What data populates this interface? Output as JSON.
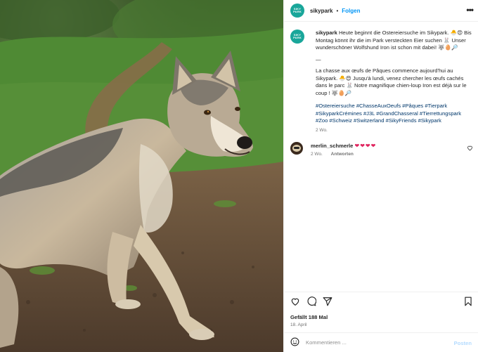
{
  "post": {
    "author": {
      "username": "sikypark",
      "avatar_text": "SIKY PARK"
    },
    "header": {
      "separator": "•",
      "follow_label": "Folgen",
      "more_label": "•••"
    },
    "caption": {
      "username": "sikypark",
      "text_de": "Heute beginnt die Ostereiersuche im Sikypark. 🐣😍 Bis Montag könnt ihr die im Park versteckten Eier suchen 🐰 Unser wunderschöner Wolfshund Iron ist schon mit dabei! 🐺🥚🔎",
      "separator_line": "—",
      "text_fr": "La chasse aux œufs de Pâques commence aujourd'hui au Sikypark. 🐣😍 Jusqu'à lundi, venez chercher les œufs cachés dans le parc 🐰 Notre magnifique chien-loup Iron est déjà sur le coup ! 🐺🥚🔎",
      "hashtags": "#Ostereiersuche #ChasseAuxOeufs #Pâques #Tierpark #SikyparkCrémines #J3L #GrandChasseral #Tierrettungspark #Zoo #Schweiz #Switzerland #SikyFriends #Sikypark",
      "time_ago": "2 Wo."
    },
    "comments": [
      {
        "username": "merlin_schmerle",
        "text": "❤❤❤❤",
        "time_ago": "2 Wo.",
        "reply_label": "Antworten"
      }
    ],
    "likes_text": "Gefällt 188 Mal",
    "date_text": "18. April",
    "composer": {
      "placeholder": "Kommentieren ...",
      "post_label": "Posten"
    },
    "icons": [
      "heart-icon",
      "comment-icon",
      "share-icon",
      "bookmark-icon",
      "emoji-icon",
      "more-icon"
    ]
  }
}
